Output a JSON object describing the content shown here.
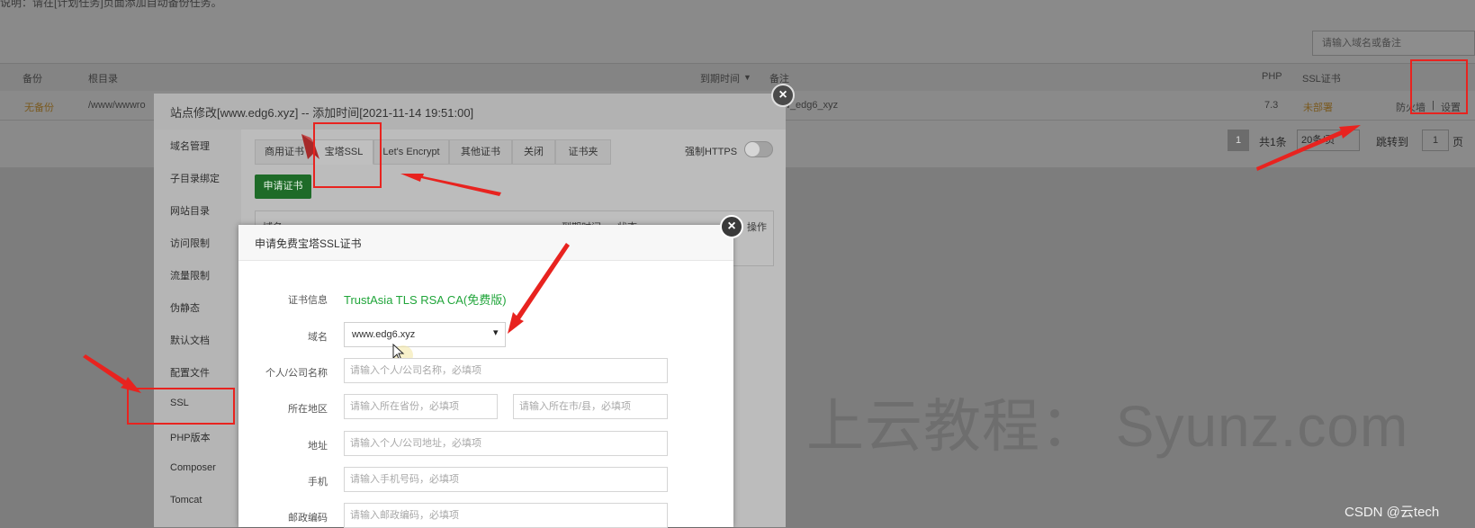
{
  "background": {
    "top_note": "说明：请在[计划任务]页面添加自动备份任务。",
    "search_placeholder": "请输入域名或备注",
    "table_headers": {
      "backup": "备份",
      "root_dir": "根目录",
      "expire": "到期时间",
      "remark": "备注",
      "php": "PHP",
      "ssl": "SSL证书"
    },
    "row": {
      "backup": "无备份",
      "root_dir": "/www/wwwro",
      "remark": "w_edg6_xyz",
      "php": "7.3",
      "ssl": "未部署",
      "firewall": "防火墙",
      "sep": "|",
      "settings": "设置"
    },
    "pagination": {
      "page": "1",
      "total": "共1条",
      "per_page": "20条/页",
      "jump_label": "跳转到",
      "jump_value": "1",
      "page_unit": "页"
    }
  },
  "dialog": {
    "title": "站点修改[www.edg6.xyz] -- 添加时间[2021-11-14 19:51:00]",
    "close": "×",
    "sidebar": [
      "域名管理",
      "子目录绑定",
      "网站目录",
      "访问限制",
      "流量限制",
      "伪静态",
      "默认文档",
      "配置文件",
      "SSL",
      "PHP版本",
      "Composer",
      "Tomcat"
    ],
    "tabs": [
      "商用证书",
      "宝塔SSL",
      "Let's Encrypt",
      "其他证书",
      "关闭",
      "证书夹"
    ],
    "force_https_label": "强制HTTPS",
    "force_https_on": false,
    "apply_button": "申请证书",
    "table_headers": [
      "域名",
      "到期时间",
      "状态",
      "操作"
    ]
  },
  "inner_dialog": {
    "title": "申请免费宝塔SSL证书",
    "close": "×",
    "cert_info_label": "证书信息",
    "cert_info_value": "TrustAsia TLS RSA CA(免费版)",
    "domain_label": "域名",
    "domain_value": "www.edg6.xyz",
    "name_label": "个人/公司名称",
    "name_placeholder": "请输入个人/公司名称，必填项",
    "region_label": "所在地区",
    "province_placeholder": "请输入所在省份，必填项",
    "city_placeholder": "请输入所在市/县，必填项",
    "address_label": "地址",
    "address_placeholder": "请输入个人/公司地址，必填项",
    "phone_label": "手机",
    "phone_placeholder": "请输入手机号码，必填项",
    "zip_label": "邮政编码",
    "zip_placeholder": "请输入邮政编码，必填项"
  },
  "overlay": {
    "watermark": "上云教程： Syunz.com",
    "credit": "CSDN @云tech",
    "annotation_color": "#e8231f"
  }
}
